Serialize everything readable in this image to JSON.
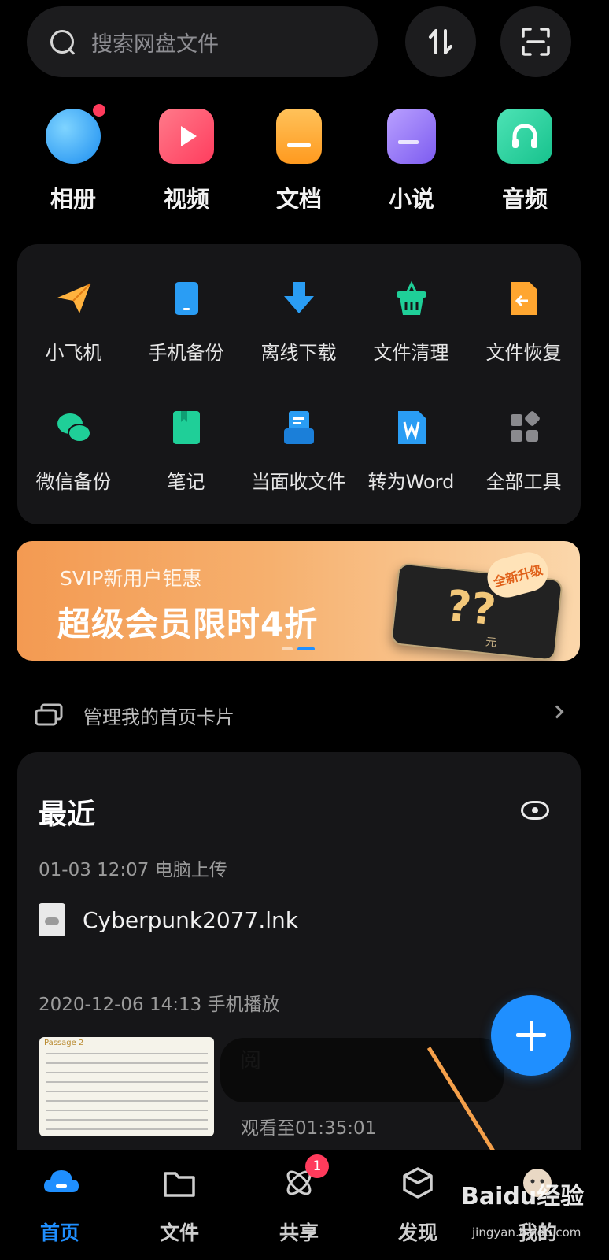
{
  "search": {
    "placeholder": "搜索网盘文件"
  },
  "categories": [
    {
      "label": "相册",
      "icon": "photo-album-icon",
      "color": "#2a9df4"
    },
    {
      "label": "视频",
      "icon": "video-icon",
      "color": "#ff4d6d"
    },
    {
      "label": "文档",
      "icon": "document-icon",
      "color": "#ffa630"
    },
    {
      "label": "小说",
      "icon": "novel-book-icon",
      "color": "#8b6cf2"
    },
    {
      "label": "音频",
      "icon": "headphones-icon",
      "color": "#1fcf98"
    }
  ],
  "tools": [
    {
      "label": "小飞机",
      "icon": "paper-plane-icon"
    },
    {
      "label": "手机备份",
      "icon": "phone-backup-icon"
    },
    {
      "label": "离线下载",
      "icon": "offline-download-icon"
    },
    {
      "label": "文件清理",
      "icon": "file-clean-icon"
    },
    {
      "label": "文件恢复",
      "icon": "file-restore-icon"
    },
    {
      "label": "微信备份",
      "icon": "wechat-backup-icon"
    },
    {
      "label": "笔记",
      "icon": "notes-icon"
    },
    {
      "label": "当面收文件",
      "icon": "receive-files-icon"
    },
    {
      "label": "转为Word",
      "icon": "convert-word-icon"
    },
    {
      "label": "全部工具",
      "icon": "all-tools-icon"
    }
  ],
  "banner": {
    "subtitle": "SVIP新用户钜惠",
    "title": "超级会员限时4折",
    "badge": "全新升级",
    "art_text": "??",
    "art_unit": "元"
  },
  "manage_cards": {
    "label": "管理我的首页卡片"
  },
  "recent": {
    "title": "最近",
    "groups": [
      {
        "meta": "01-03 12:07   电脑上传",
        "file": "Cyberpunk2077.lnk"
      },
      {
        "meta": "2020-12-06 14:13   手机播放",
        "video_title": "阅",
        "watched": "观看至01:35:01",
        "thumb_tag": "Passage 2"
      }
    ]
  },
  "nav": [
    {
      "label": "首页",
      "icon": "home-cloud-icon",
      "active": true
    },
    {
      "label": "文件",
      "icon": "folder-icon",
      "active": false
    },
    {
      "label": "共享",
      "icon": "share-atom-icon",
      "active": false,
      "badge": "1"
    },
    {
      "label": "发现",
      "icon": "discover-cube-icon",
      "active": false
    },
    {
      "label": "我的",
      "icon": "profile-icon",
      "active": false
    }
  ],
  "watermark": {
    "text": "Baidu经验",
    "sub": "jingyan.baidu.com"
  },
  "colors": {
    "accent": "#1f8fff",
    "badge_red": "#ff3b5c",
    "banner_orange": "#f39a52",
    "arrow": "#f5a04a"
  }
}
